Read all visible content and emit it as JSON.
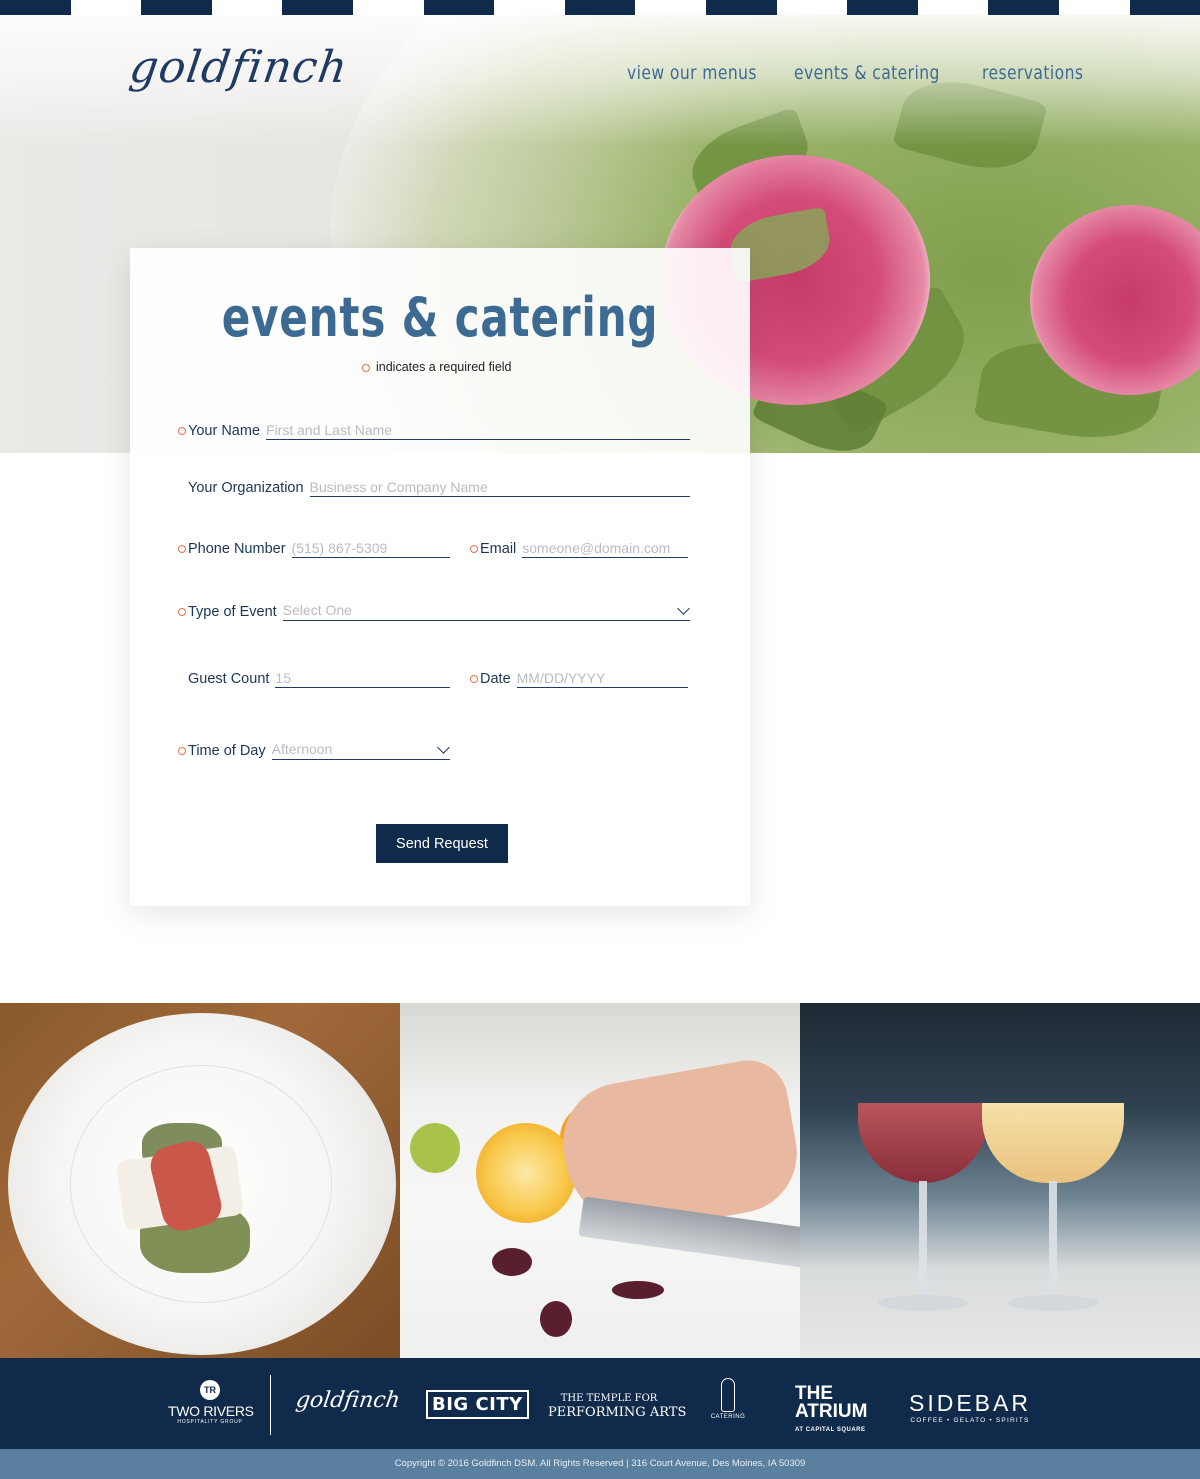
{
  "colors": {
    "navy": "#0f2a4a",
    "accent_blue": "#3d6a93",
    "required_marker": "#e8734a",
    "footer_bar": "#5b7f9e"
  },
  "header": {
    "logo": "goldfinch",
    "nav": [
      "view our menus",
      "events & catering",
      "reservations"
    ]
  },
  "form": {
    "title": "events & catering",
    "required_note": "indicates a required field",
    "fields": {
      "name": {
        "label": "Your Name",
        "placeholder": "First and Last Name",
        "required": true
      },
      "organization": {
        "label": "Your Organization",
        "placeholder": "Business or Company Name",
        "required": false
      },
      "phone": {
        "label": "Phone Number",
        "placeholder": "(515) 867-5309",
        "required": true
      },
      "email": {
        "label": "Email",
        "placeholder": "someone@domain.com",
        "required": true
      },
      "event_type": {
        "label": "Type of Event",
        "selected": "Select One",
        "required": true
      },
      "guest_count": {
        "label": "Guest Count",
        "placeholder": "15",
        "required": false
      },
      "date": {
        "label": "Date",
        "placeholder": "MM/DD/YYYY",
        "required": true
      },
      "time_of_day": {
        "label": "Time of Day",
        "selected": "Afternoon",
        "required": true
      }
    },
    "submit_label": "Send Request"
  },
  "footer": {
    "brands": {
      "two_rivers": {
        "mark": "TR",
        "name": "TWO RIVERS",
        "sub": "HOSPITALITY GROUP"
      },
      "goldfinch": "goldfinch",
      "big_city": "BIG CITY",
      "temple": {
        "line1": "THE TEMPLE FOR",
        "line2": "PERFORMING ARTS"
      },
      "catering": "CATERING",
      "atrium": {
        "line1": "THE",
        "line2": "ATRIUM",
        "sub": "AT CAPITAL SQUARE"
      },
      "sidebar": {
        "name": "SIDEBAR",
        "sub": "COFFEE • GELATO • SPIRITS"
      }
    },
    "copyright": "Copyright © 2016 Goldfinch DSM. All Rights Reserved | 316 Court Avenue, Des Moines, IA 50309"
  }
}
